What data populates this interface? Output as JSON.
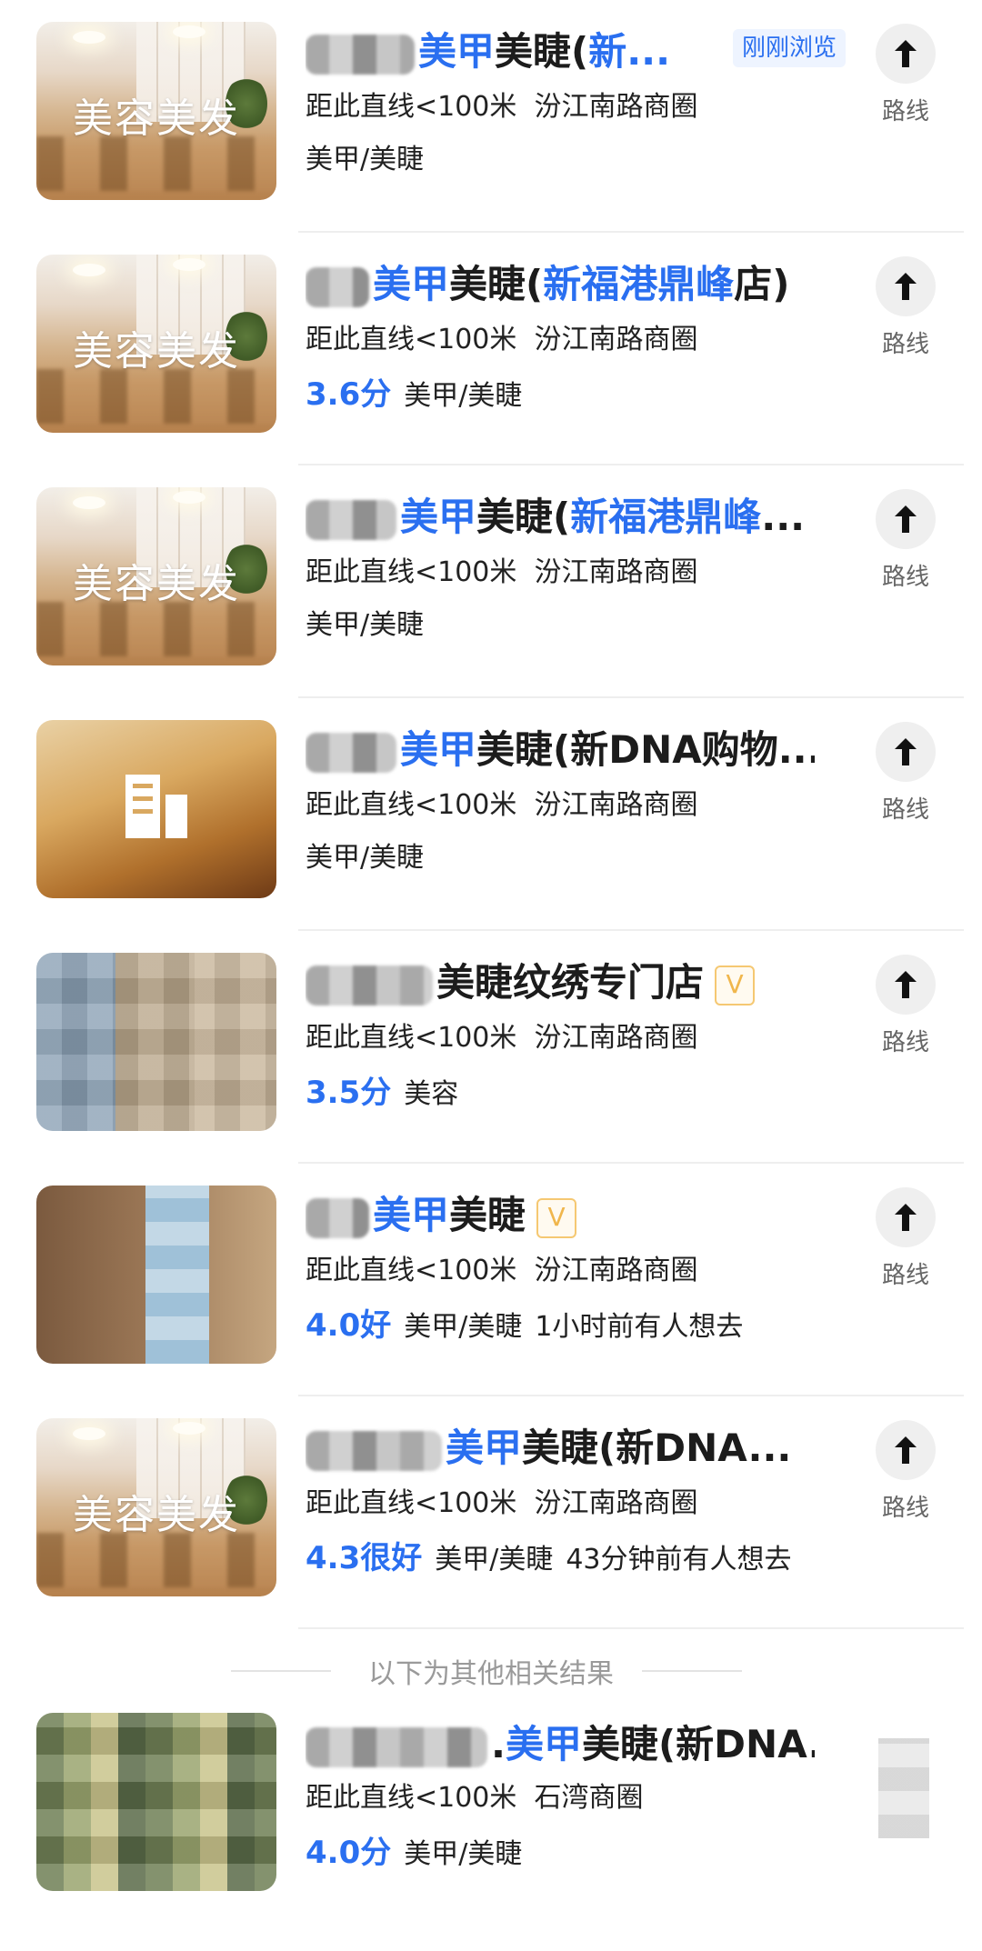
{
  "results": [
    {
      "title_prefix_blurred": true,
      "title_parts": [
        {
          "t": "美甲",
          "hl": true
        },
        {
          "t": "美睫(",
          "hl": false
        },
        {
          "t": "新...",
          "hl": true
        }
      ],
      "viewed_tag": "刚刚浏览",
      "distance": "距此直线<100米",
      "area": "汾江南路商圈",
      "score": "",
      "category": "美甲/美睫",
      "extra": "",
      "thumb": "salon",
      "thumb_caption": "美容美发",
      "route_label": "路线",
      "verified": false
    },
    {
      "title_prefix_blurred": true,
      "title_parts": [
        {
          "t": "美甲",
          "hl": true
        },
        {
          "t": "美睫(",
          "hl": false
        },
        {
          "t": "新福港鼎峰",
          "hl": true
        },
        {
          "t": "店)",
          "hl": false
        }
      ],
      "viewed_tag": "",
      "distance": "距此直线<100米",
      "area": "汾江南路商圈",
      "score": "3.6分",
      "category": "美甲/美睫",
      "extra": "",
      "thumb": "salon",
      "thumb_caption": "美容美发",
      "route_label": "路线",
      "verified": false
    },
    {
      "title_prefix_blurred": true,
      "title_parts": [
        {
          "t": "美甲",
          "hl": true
        },
        {
          "t": "美睫(",
          "hl": false
        },
        {
          "t": "新福港鼎峰",
          "hl": true
        },
        {
          "t": "...",
          "hl": false
        }
      ],
      "viewed_tag": "",
      "distance": "距此直线<100米",
      "area": "汾江南路商圈",
      "score": "",
      "category": "美甲/美睫",
      "extra": "",
      "thumb": "salon",
      "thumb_caption": "美容美发",
      "route_label": "路线",
      "verified": false
    },
    {
      "title_prefix_blurred": true,
      "title_parts": [
        {
          "t": "美甲",
          "hl": true
        },
        {
          "t": "美睫(新DNA购物...",
          "hl": false
        }
      ],
      "viewed_tag": "",
      "distance": "距此直线<100米",
      "area": "汾江南路商圈",
      "score": "",
      "category": "美甲/美睫",
      "extra": "",
      "thumb": "lobby",
      "thumb_caption": "",
      "route_label": "路线",
      "verified": false
    },
    {
      "title_prefix_blurred": true,
      "title_parts": [
        {
          "t": "美睫纹绣专门店",
          "hl": false
        }
      ],
      "viewed_tag": "",
      "distance": "距此直线<100米",
      "area": "汾江南路商圈",
      "score": "3.5分",
      "category": "美容",
      "extra": "",
      "thumb": "pix1",
      "thumb_caption": "",
      "route_label": "路线",
      "verified": true
    },
    {
      "title_prefix_blurred": true,
      "title_parts": [
        {
          "t": "美甲",
          "hl": true
        },
        {
          "t": "美睫",
          "hl": false
        }
      ],
      "viewed_tag": "",
      "distance": "距此直线<100米",
      "area": "汾江南路商圈",
      "score": "4.0好",
      "category": "美甲/美睫",
      "extra": "1小时前有人想去",
      "thumb": "room",
      "thumb_caption": "",
      "route_label": "路线",
      "verified": true
    },
    {
      "title_prefix_blurred": true,
      "title_parts": [
        {
          "t": "美甲",
          "hl": true
        },
        {
          "t": "美睫(新DNA...",
          "hl": false
        }
      ],
      "viewed_tag": "",
      "distance": "距此直线<100米",
      "area": "汾江南路商圈",
      "score": "4.3很好",
      "category": "美甲/美睫",
      "extra": "43分钟前有人想去",
      "thumb": "salon",
      "thumb_caption": "美容美发",
      "route_label": "路线",
      "verified": false
    }
  ],
  "divider_text": "以下为其他相关结果",
  "related": {
    "title_parts": [
      {
        "t": ".",
        "hl": false
      },
      {
        "t": "美甲",
        "hl": true
      },
      {
        "t": "美睫(新DNA...",
        "hl": false
      }
    ],
    "distance": "距此直线<100米",
    "area": "石湾商圈",
    "score": "4.0分",
    "category": "美甲/美睫"
  },
  "verified_glyph": "V",
  "colors": {
    "highlight": "#2a6ff0",
    "score": "#2a6ff0",
    "verified": "#f0b64c"
  }
}
